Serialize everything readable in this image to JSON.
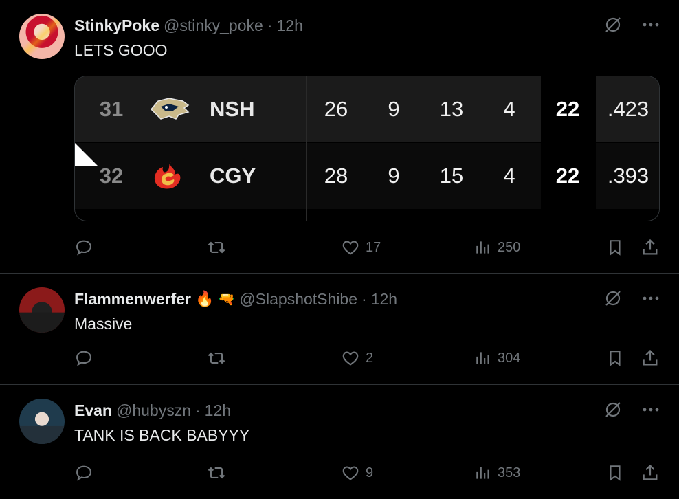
{
  "tweets": [
    {
      "name": "StinkyPoke",
      "handle": "@stinky_poke",
      "dot": "·",
      "time": "12h",
      "text": "LETS GOOO",
      "likes": "17",
      "views": "250",
      "card": {
        "rows": [
          {
            "rank": "31",
            "team": "NSH",
            "logo_icon": "predators-logo-icon",
            "c1": "26",
            "c2": "9",
            "c3": "13",
            "c4": "4",
            "pts": "22",
            "pct": ".423"
          },
          {
            "rank": "32",
            "team": "CGY",
            "logo_icon": "flames-logo-icon",
            "c1": "28",
            "c2": "9",
            "c3": "15",
            "c4": "4",
            "pts": "22",
            "pct": ".393"
          }
        ]
      }
    },
    {
      "name": "Flammenwerfer",
      "emoji1": "🔥",
      "emoji2": "🔫",
      "handle": "@SlapshotShibe",
      "dot": "·",
      "time": "12h",
      "text": "Massive",
      "likes": "2",
      "views": "304"
    },
    {
      "name": "Evan",
      "handle": "@hubyszn",
      "dot": "·",
      "time": "12h",
      "text": "TANK IS BACK BABYYY",
      "likes": "9",
      "views": "353"
    }
  ],
  "icons": [
    "reply-icon",
    "retweet-icon",
    "like-icon",
    "views-icon",
    "bookmark-icon",
    "share-icon",
    "grok-icon",
    "more-icon"
  ],
  "colors": {
    "background": "#000000",
    "text": "#e7e9ea",
    "muted": "#71767b",
    "border": "#2f3336"
  }
}
